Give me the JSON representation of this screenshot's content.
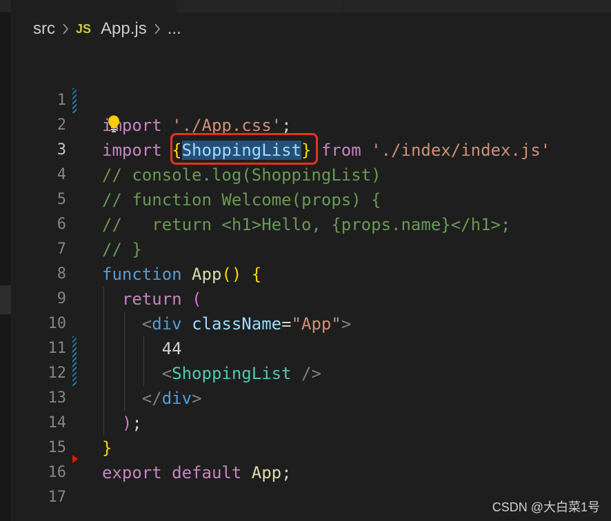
{
  "breadcrumb": {
    "folder": "src",
    "file_icon": "JS",
    "file": "App.js",
    "more": "..."
  },
  "editor": {
    "line_numbers": [
      "1",
      "2",
      "3",
      "4",
      "5",
      "6",
      "7",
      "8",
      "9",
      "10",
      "11",
      "12",
      "13",
      "14",
      "15",
      "16",
      "17"
    ],
    "active_line": "3",
    "lines": {
      "l2": {
        "kw": "import",
        "str": "'./App.css'",
        "end": ";"
      },
      "l3": {
        "kw": "import",
        "open": "{",
        "name": "ShoppingList",
        "close": "}",
        "from": "from",
        "str": "'./index/index.js'"
      },
      "l4": "// console.log(ShoppingList)",
      "l5": "// function Welcome(props) {",
      "l6": "//   return <h1>Hello, {props.name}</h1>;",
      "l7": "// }",
      "l8": {
        "kw": "function",
        "name": "App",
        "parens": "()",
        "brace": "{"
      },
      "l9": {
        "kw": "return",
        "paren": "("
      },
      "l10": {
        "lt": "<",
        "tag": "div",
        "attr": "className",
        "eq": "=",
        "val": "\"App\"",
        "gt": ">"
      },
      "l11": "44",
      "l12": {
        "lt": "<",
        "comp": "ShoppingList",
        "close": "/>"
      },
      "l13": {
        "lt": "</",
        "tag": "div",
        "gt": ">"
      },
      "l14": {
        "paren": ")",
        "semi": ";"
      },
      "l15": {
        "brace": "}"
      },
      "l16": {
        "export": "export",
        "default": "default",
        "name": "App",
        "semi": ";"
      }
    }
  },
  "watermark": "CSDN @大白菜1号",
  "colors": {
    "background": "#1e1e1e",
    "highlight_box": "#e8321c",
    "selection": "#264f78"
  }
}
